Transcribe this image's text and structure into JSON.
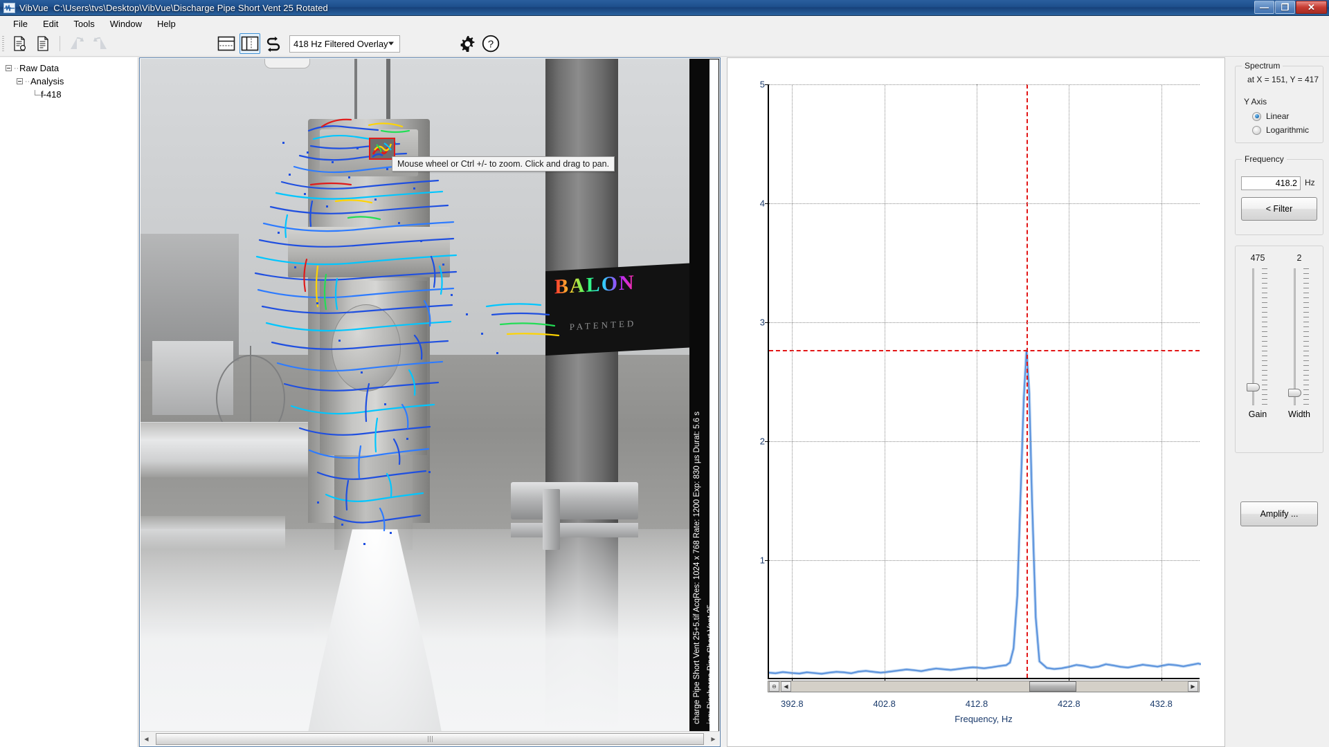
{
  "window": {
    "app_name": "VibVue",
    "file_path": "C:\\Users\\tvs\\Desktop\\VibVue\\Discharge Pipe Short Vent 25 Rotated",
    "app_icon": "waveform-icon",
    "minimize_label": "—",
    "restore_label": "❐",
    "close_label": "✕"
  },
  "menu": {
    "items": [
      {
        "label": "File"
      },
      {
        "label": "Edit"
      },
      {
        "label": "Tools"
      },
      {
        "label": "Window"
      },
      {
        "label": "Help"
      }
    ]
  },
  "toolbar": {
    "new_doc_icon": "new-document-icon",
    "open_doc_icon": "open-document-icon",
    "undo_icon": "undo-arrow-icon",
    "redo_icon": "redo-arrow-icon",
    "layout_horizontal_icon": "layout-horizontal-split-icon",
    "layout_vertical_icon": "layout-vertical-split-icon",
    "swap_icon": "swap-panels-icon",
    "overlay_mode": "418 Hz Filtered Overlay",
    "overlay_caret_icon": "chevron-down-icon",
    "settings_icon": "gear-icon",
    "help_icon": "question-mark-icon"
  },
  "tree": {
    "nodes": [
      {
        "label": "Raw Data",
        "level": 1
      },
      {
        "label": "Analysis",
        "level": 2
      },
      {
        "label": "f-418",
        "level": 3
      }
    ]
  },
  "image_panel": {
    "tooltip": "Mouse wheel or Ctrl +/- to zoom. Click and drag to pan.",
    "magnifier_icon": "magnifier-preview-box",
    "meta_line_1": "charge Pipe Short Vent 25+5.tif  AcqRes: 1024 x 768  Rate: 1200  Exp: 830 µs  Durat: 5.6 s",
    "meta_line_2": "ion: Discharge Pipe Short Vent 25",
    "overlay_label": "BALON",
    "overlay_sub": "PATENTED",
    "scroll_left_icon": "scroll-left-arrow-icon",
    "scroll_right_icon": "scroll-right-arrow-icon"
  },
  "chart_data": {
    "type": "line",
    "title": "",
    "xlabel": "Frequency, Hz",
    "ylabel": "",
    "xlim": [
      390.3,
      437.1
    ],
    "ylim": [
      0,
      5
    ],
    "grid": true,
    "legend": "none",
    "xticks": [
      "392.8",
      "402.8",
      "412.8",
      "422.8",
      "432.8"
    ],
    "xtick_values": [
      392.8,
      402.8,
      412.8,
      422.8,
      432.8
    ],
    "yticks": [
      "1",
      "2",
      "3",
      "4",
      "5"
    ],
    "ytick_values": [
      1,
      2,
      3,
      4,
      5
    ],
    "series": [
      {
        "name": "Spectrum",
        "color": "#4a86d8",
        "x": [
          390.3,
          391.0,
          391.8,
          392.8,
          393.6,
          394.4,
          395.2,
          396.0,
          396.8,
          397.6,
          398.4,
          399.2,
          400.0,
          400.8,
          401.6,
          402.4,
          402.8,
          403.6,
          404.4,
          405.2,
          406.0,
          406.8,
          407.6,
          408.4,
          409.2,
          410.0,
          410.8,
          411.6,
          412.4,
          412.8,
          413.6,
          414.4,
          415.2,
          416.0,
          416.4,
          416.8,
          417.2,
          417.6,
          417.9,
          418.2,
          418.5,
          418.8,
          419.2,
          419.6,
          420.4,
          421.2,
          422.0,
          422.8,
          423.6,
          424.4,
          425.2,
          426.0,
          426.8,
          427.6,
          428.4,
          429.2,
          430.0,
          430.8,
          431.6,
          432.4,
          432.8,
          433.6,
          434.4,
          435.2,
          436.0,
          436.8,
          437.1
        ],
        "y": [
          0.055,
          0.05,
          0.06,
          0.052,
          0.048,
          0.058,
          0.052,
          0.046,
          0.055,
          0.062,
          0.058,
          0.05,
          0.064,
          0.07,
          0.062,
          0.055,
          0.058,
          0.066,
          0.074,
          0.082,
          0.076,
          0.068,
          0.08,
          0.09,
          0.084,
          0.078,
          0.086,
          0.094,
          0.1,
          0.098,
          0.092,
          0.1,
          0.11,
          0.118,
          0.14,
          0.26,
          0.7,
          1.65,
          2.35,
          2.77,
          2.4,
          1.5,
          0.52,
          0.15,
          0.095,
          0.086,
          0.092,
          0.104,
          0.12,
          0.112,
          0.098,
          0.106,
          0.126,
          0.116,
          0.104,
          0.098,
          0.11,
          0.122,
          0.114,
          0.106,
          0.112,
          0.124,
          0.118,
          0.108,
          0.12,
          0.132,
          0.126
        ]
      }
    ],
    "annotations": {
      "cursor_vertical_x": 418.2,
      "cursor_horizontal_y": 2.77,
      "cursor_color": "#e21414",
      "cursor_style": "dashed"
    },
    "scrollbar": {
      "zoom_out_icon": "zoom-out-icon",
      "left_arrow_icon": "scroll-left-arrow-icon",
      "right_arrow_icon": "scroll-right-arrow-icon"
    }
  },
  "right_panel": {
    "spectrum": {
      "title": "Spectrum",
      "cursor_readout": "at  X = 151, Y = 417",
      "y_axis_label": "Y Axis",
      "options": [
        {
          "label": "Linear",
          "selected": true
        },
        {
          "label": "Logarithmic",
          "selected": false
        }
      ]
    },
    "frequency": {
      "title": "Frequency",
      "value": "418.2",
      "unit": "Hz",
      "filter_button": "< Filter"
    },
    "sliders": [
      {
        "name": "Gain",
        "value": "475"
      },
      {
        "name": "Width",
        "value": "2"
      }
    ],
    "amplify_button": "Amplify ..."
  }
}
